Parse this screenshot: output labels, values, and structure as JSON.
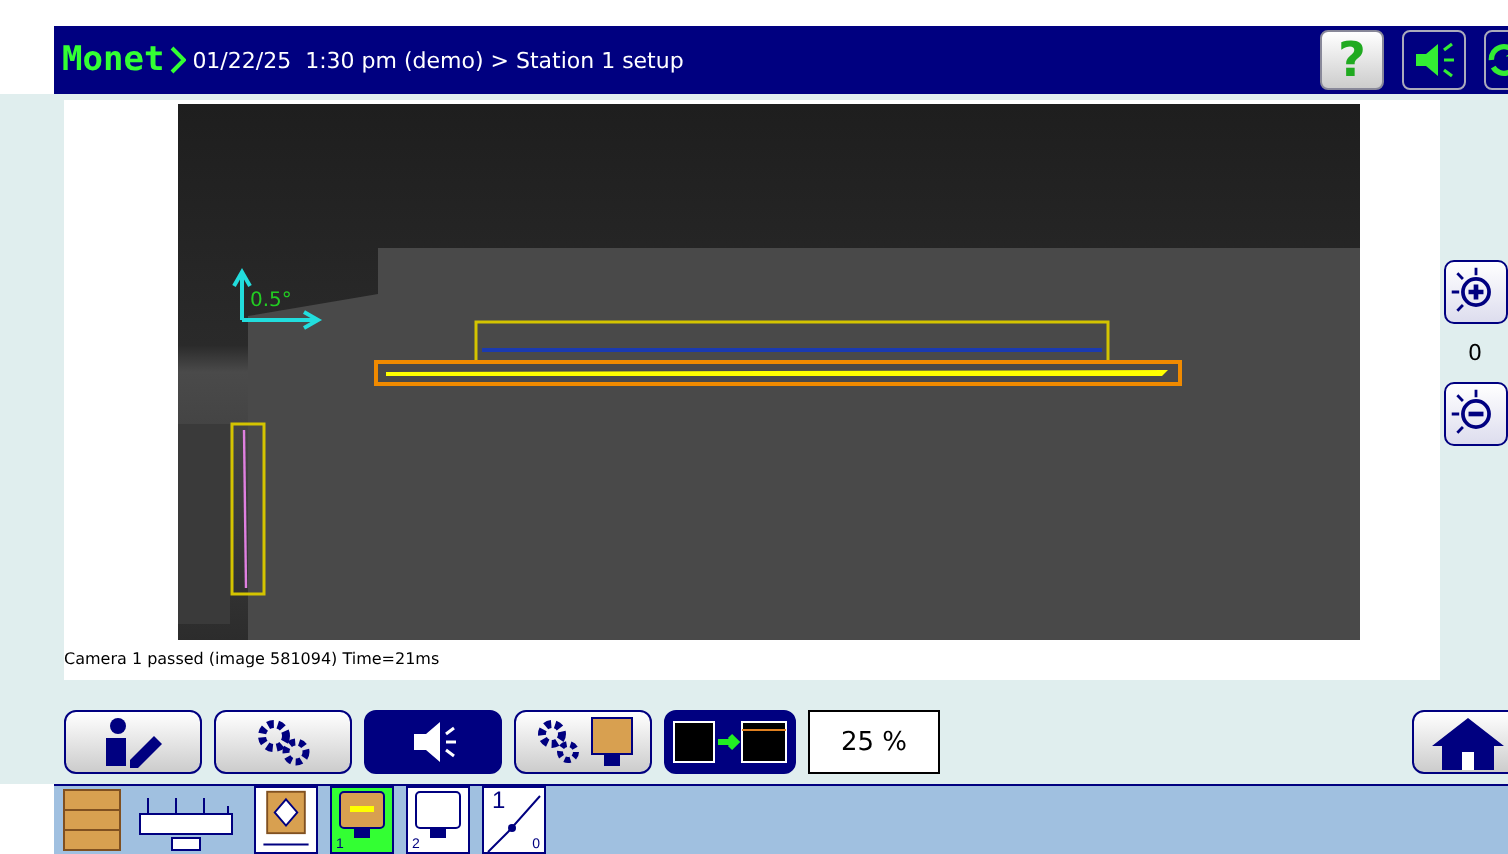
{
  "header": {
    "logo": "Monet",
    "breadcrumb": "01/22/25  1:30 pm (demo) > Station 1 setup",
    "buttons": [
      {
        "kind": "help",
        "label": "?"
      },
      {
        "kind": "sound"
      },
      {
        "kind": "refresh"
      }
    ]
  },
  "camera": {
    "angle": "0.5°",
    "status": "Camera 1 passed (image 581094) Time=21ms"
  },
  "side_panel": {
    "reading": "0"
  },
  "action_buttons": [
    {
      "kind": "operator",
      "selected": false
    },
    {
      "kind": "settings",
      "selected": false
    },
    {
      "kind": "sound",
      "selected": true
    },
    {
      "kind": "camera-settings",
      "selected": false
    },
    {
      "kind": "display",
      "selected": true
    }
  ],
  "zoom_field": {
    "value": "25 %"
  },
  "tools": [
    {
      "kind": "conveyor",
      "selected": false
    },
    {
      "kind": "sensor",
      "selected": false
    },
    {
      "kind": "camera-1",
      "label": "1",
      "selected": true
    },
    {
      "kind": "camera-2",
      "label": "2",
      "selected": false
    },
    {
      "kind": "scale",
      "label": "1",
      "sublabel": "0",
      "selected": false
    }
  ]
}
